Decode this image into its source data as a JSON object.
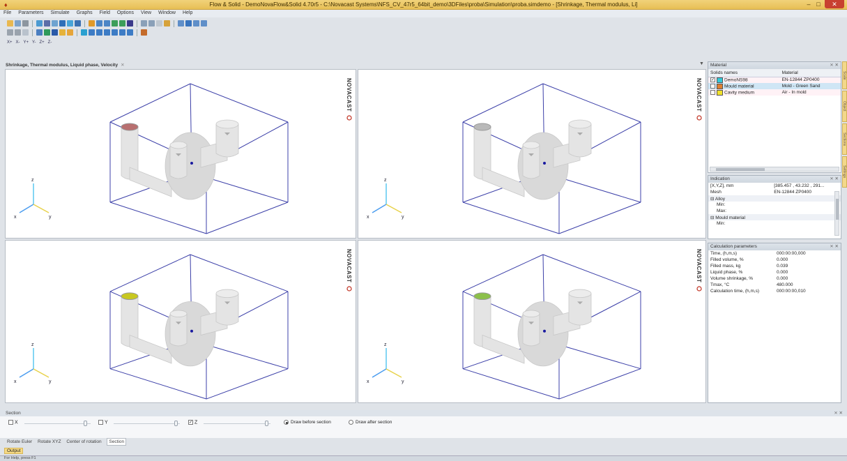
{
  "window": {
    "title": "Flow & Solid - DemoNovaFlow&Solid 4.70r5 - C:\\Novacast Systems\\NFS_CV_47r5_64bit_demo\\3DFiles\\proba\\Simulation\\proba.simdemo - [Shrinkage, Thermal modulus, Li]",
    "minimize": "–",
    "maximize": "□",
    "close": "✕"
  },
  "menu": [
    "File",
    "Parameters",
    "Simulate",
    "Graphs",
    "Field",
    "Options",
    "View",
    "Window",
    "Help"
  ],
  "toolbar3_labels": [
    "X+",
    "X-",
    "Y+",
    "Y-",
    "Z+",
    "Z-"
  ],
  "doc_tab": {
    "label": "Shrinkage, Thermal modulus, Liquid phase, Velocity",
    "close": "✕"
  },
  "brand": "NOVACAST",
  "axes": {
    "x": "x",
    "y": "y",
    "z": "z"
  },
  "viewports": [
    {
      "name": "shrinkage",
      "top_color": "#b87070"
    },
    {
      "name": "thermal-modulus",
      "top_color": "#b9b9b9"
    },
    {
      "name": "liquid-phase",
      "top_color": "#c8c820"
    },
    {
      "name": "velocity",
      "top_color": "#8cc04a"
    }
  ],
  "material": {
    "title": "Material",
    "columns": [
      "Solids names",
      "Material"
    ],
    "rows": [
      {
        "name": "DemoNS98",
        "material": "EN-12844 ZP0400",
        "color": "#33c9d8",
        "checked": true
      },
      {
        "name": "Mould material",
        "material": "Mold - Green Sand",
        "color": "#e07f30",
        "checked": false
      },
      {
        "name": "Cavity medium",
        "material": "Air - In mold",
        "color": "#f0e12a",
        "checked": false
      }
    ]
  },
  "indication": {
    "title": "Indication",
    "rows": [
      {
        "label": "[X,Y,Z], mm",
        "value": "[385.457 , 43.232 , 291..."
      },
      {
        "label": "Mesh",
        "value": "EN-12844 ZP0400"
      },
      {
        "label": "Alloy",
        "value": "",
        "group": true
      },
      {
        "label": "Min:",
        "value": ""
      },
      {
        "label": "Max:",
        "value": ""
      },
      {
        "label": "Mould material",
        "value": "",
        "group": true
      },
      {
        "label": "Min:",
        "value": ""
      }
    ]
  },
  "calc": {
    "title": "Calculation parameters",
    "rows": [
      {
        "label": "Time, (h,m,s)",
        "value": "000:00:00,000"
      },
      {
        "label": "Filled volume, %",
        "value": "0.000"
      },
      {
        "label": "Filled mass, kg",
        "value": "0.039"
      },
      {
        "label": "Liquid phase, %",
        "value": "0.000"
      },
      {
        "label": "Volume shrinkage, %",
        "value": "0.000"
      },
      {
        "label": "Tmax, °C",
        "value": "480.000"
      },
      {
        "label": "Calculation time, (h,m,s)",
        "value": "000:00:00,010"
      }
    ]
  },
  "side_tabs": [
    "Scale",
    "Object",
    "Sections",
    "Settings"
  ],
  "section": {
    "title": "Section",
    "x_label": "X",
    "y_label": "Y",
    "z_label": "Z",
    "x_checked": false,
    "y_checked": false,
    "z_checked": true,
    "draw_before": "Draw before section",
    "draw_after": "Draw after section",
    "selected": "before"
  },
  "bottom_tabs": [
    "Rotate Euler",
    "Rotate XYZ",
    "Center of rotation",
    "Section"
  ],
  "bottom_active": "Section",
  "output_tab": "Output",
  "status": "For Help, press F1",
  "pin": "⨯ ✕"
}
